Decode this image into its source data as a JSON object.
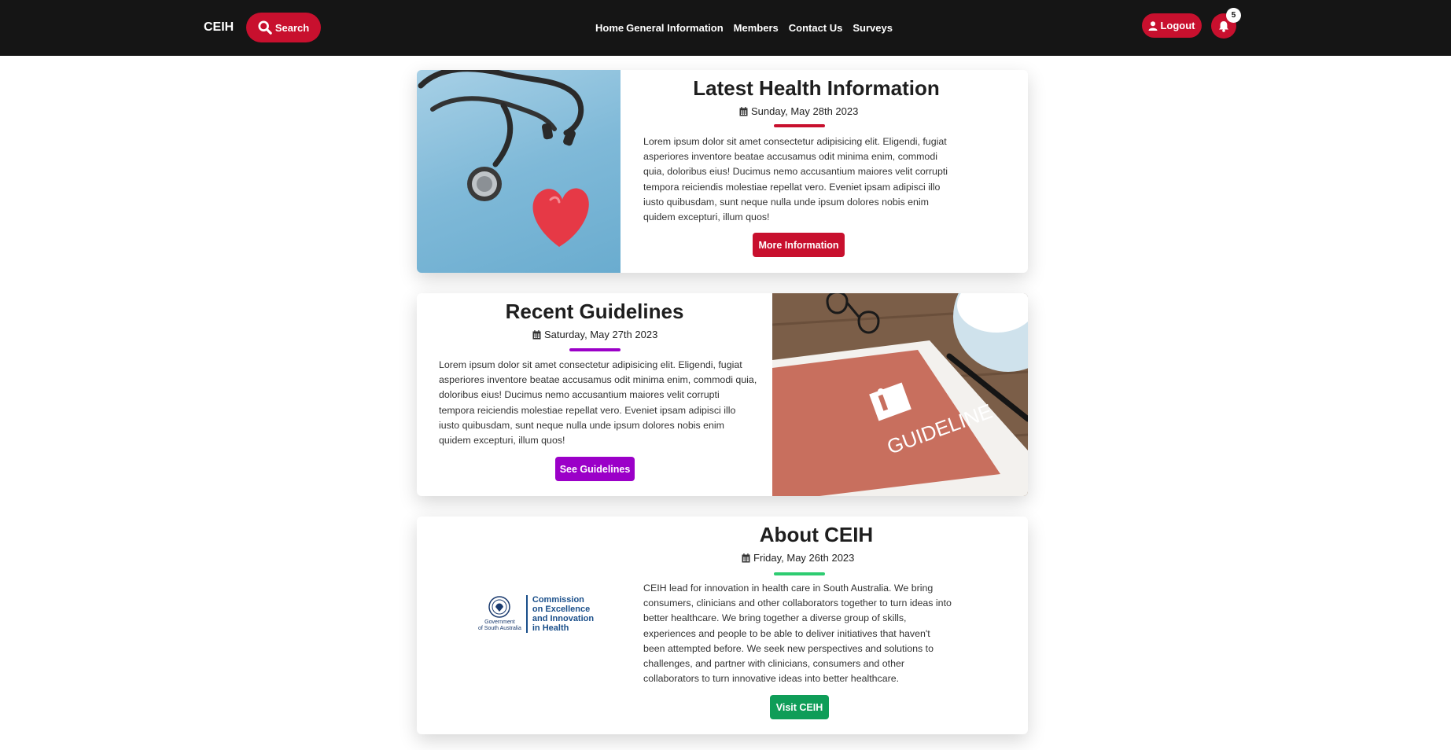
{
  "nav": {
    "brand": "CEIH",
    "search_label": "Search",
    "links": [
      "Home",
      "General Information",
      "Members",
      "Contact Us",
      "Surveys"
    ],
    "logout_label": "Logout",
    "notification_count": "5"
  },
  "cards": [
    {
      "title": "Latest Health Information",
      "date": "Sunday, May 28th 2023",
      "text": "Lorem ipsum dolor sit amet consectetur adipisicing elit. Eligendi, fugiat asperiores inventore beatae accusamus odit minima enim, commodi quia, doloribus eius! Ducimus nemo accusantium maiores velit corrupti tempora reiciendis molestiae repellat vero. Eveniet ipsam adipisci illo iusto quibusdam, sunt neque nulla unde ipsum dolores nobis enim quidem excepturi, illum quos!",
      "button": "More Information",
      "accent": "#c8102e"
    },
    {
      "title": "Recent Guidelines",
      "date": "Saturday, May 27th 2023",
      "text": "Lorem ipsum dolor sit amet consectetur adipisicing elit. Eligendi, fugiat asperiores inventore beatae accusamus odit minima enim, commodi quia, doloribus eius! Ducimus nemo accusantium maiores velit corrupti tempora reiciendis molestiae repellat vero. Eveniet ipsam adipisci illo iusto quibusdam, sunt neque nulla unde ipsum dolores nobis enim quidem excepturi, illum quos!",
      "button": "See Guidelines",
      "accent": "#9b00c8",
      "image_text": "GUIDELINE"
    },
    {
      "title": "About CEIH",
      "date": "Friday, May 26th 2023",
      "text": "CEIH lead for innovation in health care in South Australia. We bring consumers, clinicians and other collaborators together to turn ideas into better healthcare. We bring together a diverse group of skills, experiences and people to be able to deliver initiatives that haven't been attempted before. We seek new perspectives and solutions to challenges, and partner with clinicians, consumers and other collaborators to turn innovative ideas into better healthcare.",
      "button": "Visit CEIH",
      "accent": "#0f9d58",
      "logo": {
        "gov_line1": "Government",
        "gov_line2": "of South Australia",
        "org_lines": [
          "Commission",
          "on Excellence",
          "and Innovation",
          "in Health"
        ]
      }
    }
  ],
  "icons": {
    "search": "search-icon",
    "user": "user-icon",
    "bell": "bell-icon",
    "calendar": "calendar-icon"
  }
}
